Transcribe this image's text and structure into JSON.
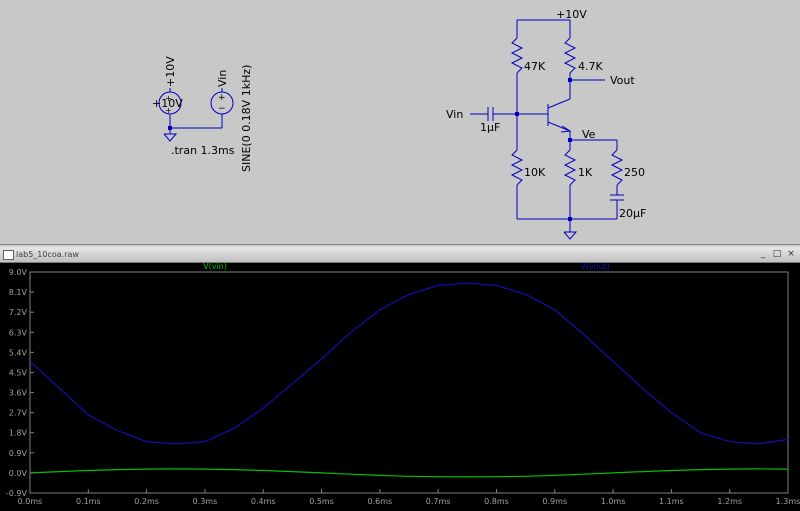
{
  "schematic": {
    "vsource1": {
      "name": "+10V",
      "value": "+10V"
    },
    "vsource2": {
      "name": "Vin",
      "value": "SINE(0 0.18V 1kHz)"
    },
    "directive": ".tran 1.3ms",
    "supply_label": "+10V",
    "labels": {
      "r1": "47K",
      "r2": "4.7K",
      "r3": "10K",
      "r4": "1K",
      "r5": "250",
      "c1": "1µF",
      "c2": "20µF",
      "vin": "Vin",
      "vout": "Vout",
      "ve": "Ve"
    }
  },
  "plot_window": {
    "title": "lab5_10coa.raw",
    "buttons": [
      "_",
      "□",
      "×"
    ]
  },
  "chart_data": {
    "type": "line",
    "xlabel": "",
    "ylabel": "",
    "xlim": [
      0,
      1.3
    ],
    "ylim": [
      -0.9,
      9.0
    ],
    "x_ticks": [
      "0.0ms",
      "0.1ms",
      "0.2ms",
      "0.3ms",
      "0.4ms",
      "0.5ms",
      "0.6ms",
      "0.7ms",
      "0.8ms",
      "0.9ms",
      "1.0ms",
      "1.1ms",
      "1.2ms",
      "1.3ms"
    ],
    "y_ticks": [
      "9.0V",
      "8.1V",
      "7.2V",
      "6.3V",
      "5.4V",
      "4.5V",
      "3.6V",
      "2.7V",
      "1.8V",
      "0.9V",
      "0.0V",
      "-0.9V"
    ],
    "grid": false,
    "series": [
      {
        "name": "V(vin)",
        "color": "#00c000",
        "x": [
          0,
          0.05,
          0.1,
          0.15,
          0.2,
          0.25,
          0.3,
          0.35,
          0.4,
          0.45,
          0.5,
          0.55,
          0.6,
          0.65,
          0.7,
          0.75,
          0.8,
          0.85,
          0.9,
          0.95,
          1.0,
          1.05,
          1.1,
          1.15,
          1.2,
          1.25,
          1.3
        ],
        "y": [
          0,
          0.06,
          0.11,
          0.15,
          0.17,
          0.18,
          0.17,
          0.15,
          0.11,
          0.06,
          0,
          -0.06,
          -0.11,
          -0.15,
          -0.17,
          -0.18,
          -0.17,
          -0.15,
          -0.11,
          -0.06,
          0,
          0.06,
          0.11,
          0.15,
          0.17,
          0.18,
          0.17
        ]
      },
      {
        "name": "V(vout)",
        "color": "#1010b0",
        "x": [
          0,
          0.05,
          0.1,
          0.15,
          0.2,
          0.25,
          0.3,
          0.35,
          0.4,
          0.45,
          0.5,
          0.55,
          0.6,
          0.65,
          0.7,
          0.75,
          0.8,
          0.85,
          0.9,
          0.95,
          1.0,
          1.05,
          1.1,
          1.15,
          1.2,
          1.25,
          1.3
        ],
        "y": [
          5.0,
          3.8,
          2.6,
          1.9,
          1.4,
          1.3,
          1.4,
          2.0,
          2.9,
          4.0,
          5.1,
          6.3,
          7.3,
          8.0,
          8.4,
          8.5,
          8.4,
          8.0,
          7.3,
          6.2,
          5.0,
          3.8,
          2.7,
          1.8,
          1.4,
          1.3,
          1.5
        ]
      }
    ]
  }
}
